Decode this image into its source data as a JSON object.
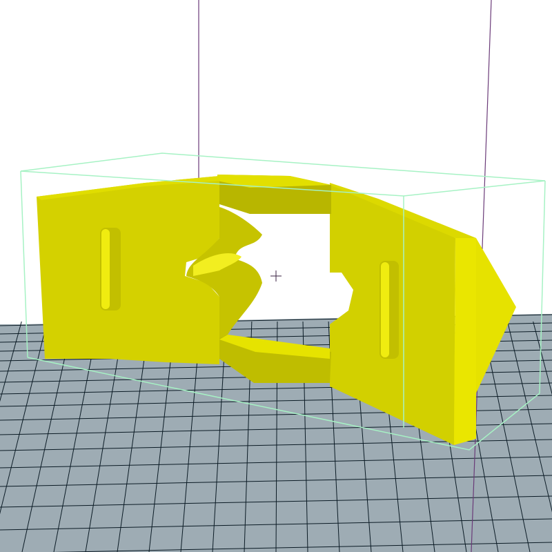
{
  "viewport": {
    "name": "3d-print-preview",
    "background": "#ffffff",
    "bed_fill": "#9eacb4",
    "bed_grid_color": "#0a1a24",
    "axis_color": "#6a3a78",
    "bounding_box_color": "#a6f2c4",
    "model_colors": {
      "front": "#d2d000",
      "front_dark": "#b8b600",
      "top": "#e6e200",
      "side_light": "#f0ec10",
      "shadow": "#8a8700"
    }
  }
}
